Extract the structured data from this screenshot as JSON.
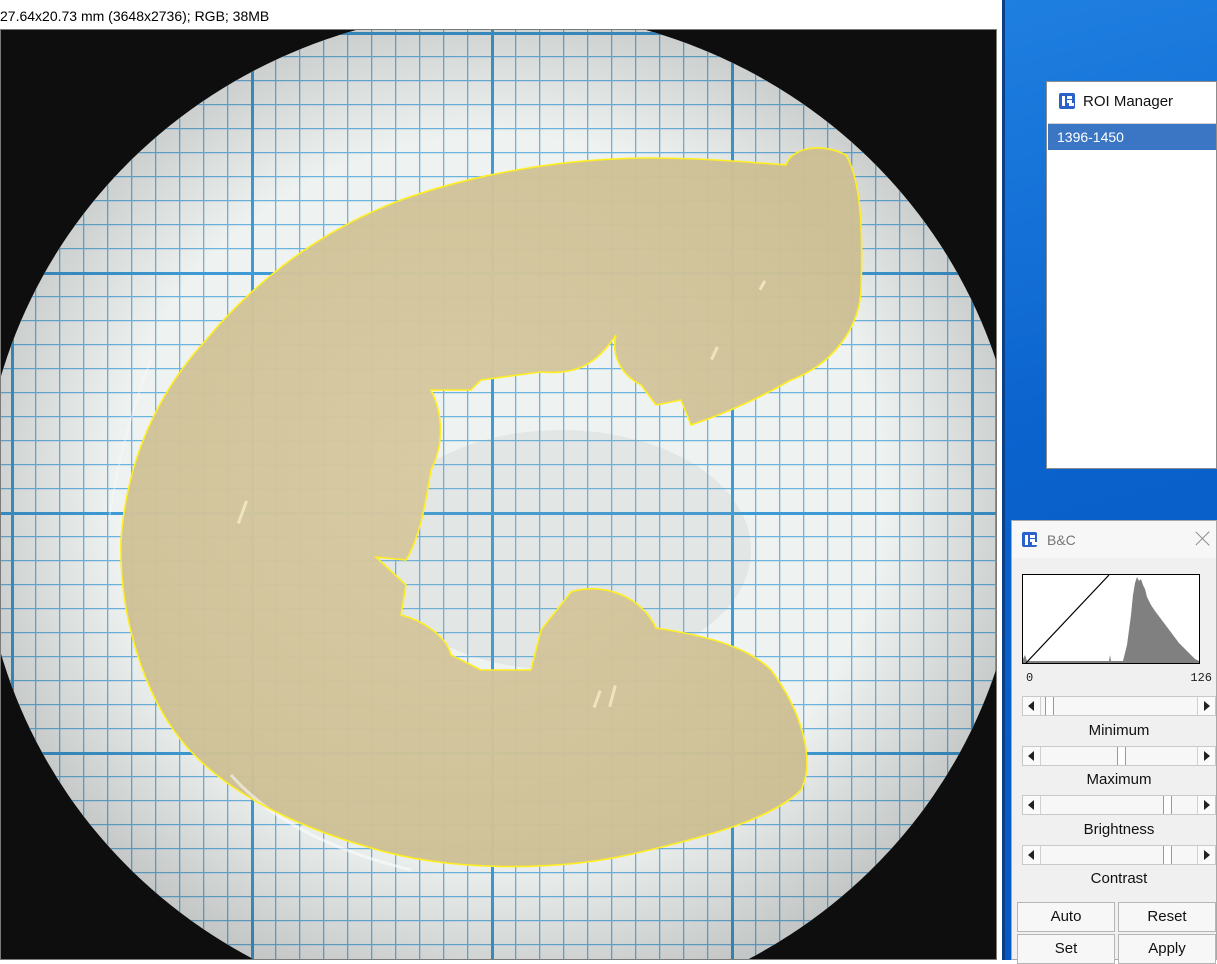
{
  "image_window": {
    "info_text": "27.64x20.73 mm (3648x2736); RGB; 38MB"
  },
  "roi_manager": {
    "title": "ROI Manager",
    "items": [
      {
        "label": "1396-1450",
        "selected": true
      }
    ]
  },
  "bc_window": {
    "title": "B&C",
    "histogram": {
      "min_label": "0",
      "max_label": "126"
    },
    "sliders": [
      {
        "label": "Minimum",
        "value": 0.03
      },
      {
        "label": "Maximum",
        "value": 0.52
      },
      {
        "label": "Brightness",
        "value": 0.83
      },
      {
        "label": "Contrast",
        "value": 0.83
      }
    ],
    "buttons": {
      "auto": "Auto",
      "reset": "Reset",
      "set": "Set",
      "apply": "Apply"
    }
  },
  "colors": {
    "roi_outline": "#ffee22",
    "selection": "#3a76c4",
    "desktop": "#0a62cd",
    "grid_line": "#4aa3d8"
  }
}
